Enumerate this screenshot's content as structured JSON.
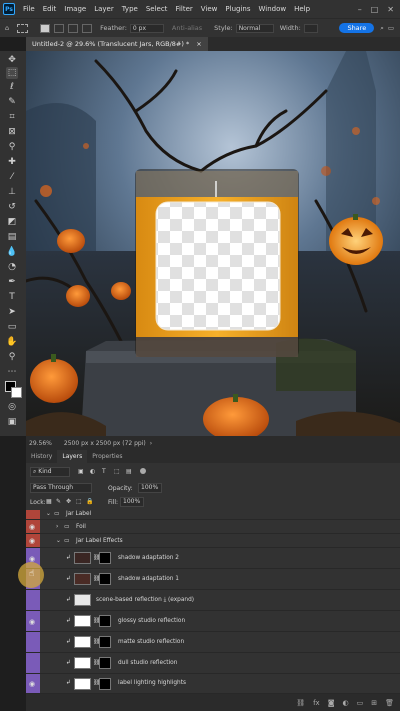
{
  "app": {
    "name": "Ps"
  },
  "menu": [
    "File",
    "Edit",
    "Image",
    "Layer",
    "Type",
    "Select",
    "Filter",
    "View",
    "Plugins",
    "Window",
    "Help"
  ],
  "options": {
    "feather_label": "Feather:",
    "feather_value": "0 px",
    "anti_alias": "Anti-alias",
    "style_label": "Style:",
    "style_value": "Normal",
    "width_label": "Width:",
    "share": "Share"
  },
  "document": {
    "tab_title": "Untitled-2 @ 29.6% (Translucent Jars, RGB/8#) *",
    "zoom": "29.56%",
    "dims": "2500 px x 2500 px (72 ppi)"
  },
  "panel": {
    "tabs": [
      "History",
      "Layers",
      "Properties"
    ],
    "kind": "Kind",
    "blend": "Pass Through",
    "opacity_label": "Opacity:",
    "opacity": "100%",
    "lock_label": "Lock:",
    "fill_label": "Fill:",
    "fill": "100%",
    "layers": [
      {
        "name": "Jar Label",
        "kind": "group"
      },
      {
        "name": "Foil",
        "kind": "group"
      },
      {
        "name": "Jar Label Effects",
        "kind": "group"
      },
      {
        "name": "shadow adaptation 2",
        "kind": "layer"
      },
      {
        "name": "shadow adaptation 1",
        "kind": "layer"
      },
      {
        "name": "scene-based reflection ⤓ (expand)",
        "kind": "smart"
      },
      {
        "name": "glossy studio reflection",
        "kind": "layer"
      },
      {
        "name": "matte studio reflection",
        "kind": "layer"
      },
      {
        "name": "dull studio reflection",
        "kind": "layer"
      },
      {
        "name": "label lighting highlights",
        "kind": "layer"
      }
    ]
  },
  "colors": {
    "accent": "#1473e6",
    "red_visibility": "#b0453a",
    "purple_visibility": "#7a5bb8",
    "label_yellow": "#f2a922"
  }
}
